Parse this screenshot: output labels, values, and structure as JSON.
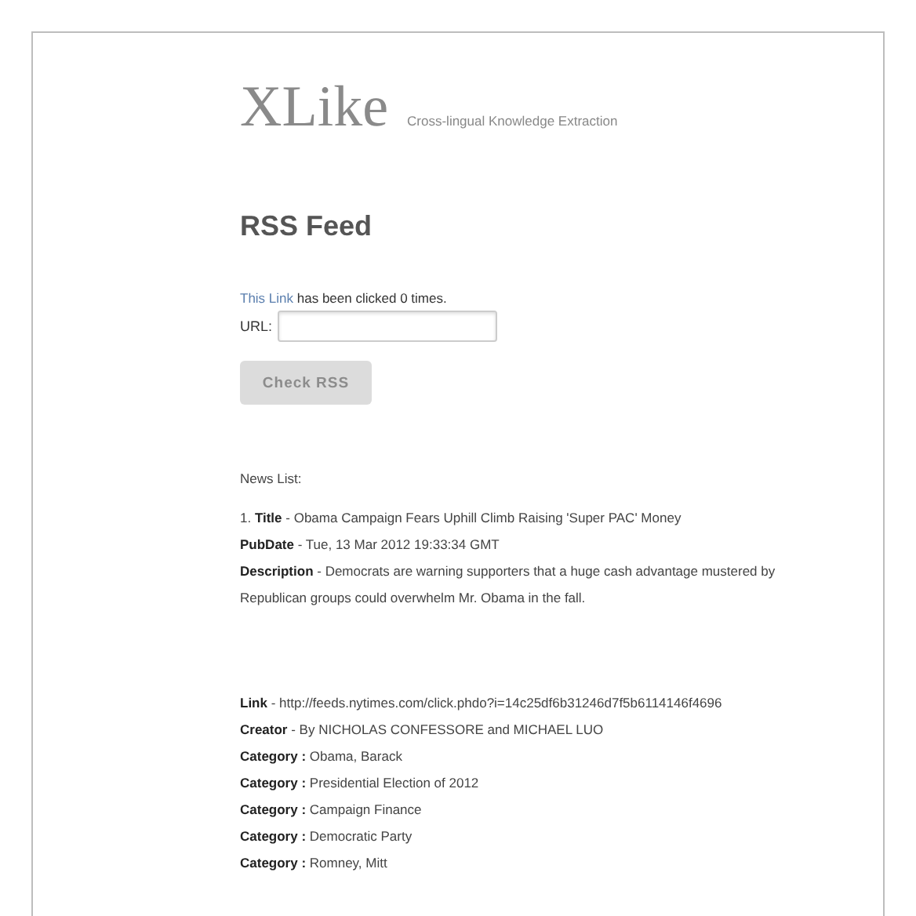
{
  "logo": {
    "name": "XLike",
    "tagline": "Cross-lingual Knowledge Extraction"
  },
  "heading": "RSS Feed",
  "click_note": {
    "link": "This Link",
    "text": "has been clicked 0 times."
  },
  "url_field": {
    "label": "URL:"
  },
  "check_button": {
    "label": "Check RSS",
    "disabled": true
  },
  "news": {
    "title": "News List:",
    "summary_lines": [
      "1. **Title** - Obama Campaign Fears Uphill Climb Raising 'Super PAC' Money",
      "**PubDate** - Tue, 13 Mar 2012 19:33:34 GMT",
      "**Description** - Democrats are warning supporters that a huge cash advantage mustered by Republican groups could overwhelm Mr. Obama in the fall."
    ],
    "detail_lines": [
      "**Link** - http://feeds.nytimes.com/click.phdo?i=14c25df6b31246d7f5b6114146f4696",
      "**Creator** - By NICHOLAS CONFESSORE and MICHAEL LUO",
      "**Category :** Obama, Barack",
      "**Category :** Presidential Election of 2012",
      "**Category :** Campaign Finance",
      "**Category :** Democratic Party",
      "**Category :** Romney, Mitt"
    ]
  }
}
